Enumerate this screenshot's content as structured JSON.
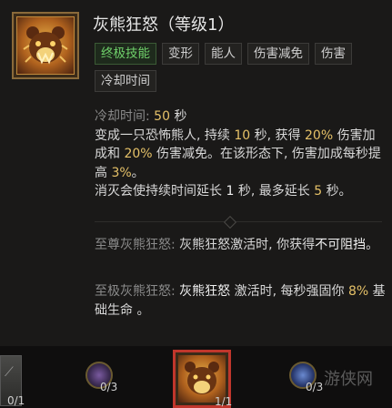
{
  "skill": {
    "title": "灰熊狂怒（等级1）",
    "icon": "bear-head-icon",
    "tags": [
      "终极技能",
      "变形",
      "能人",
      "伤害减免",
      "伤害",
      "冷却时间"
    ]
  },
  "description": {
    "cooldown_label": "冷却时间:",
    "cooldown_value": "50",
    "cooldown_unit": "秒",
    "p1_a": "变成一只恐怖熊人, 持续",
    "p1_duration": "10",
    "p1_b": "秒, 获得",
    "p1_dmg": "20%",
    "p1_c": "伤害加成和",
    "p1_dr": "20%",
    "p1_d": "伤害减免。在该形态下, 伤害加成每秒提高",
    "p1_inc": "3%",
    "p1_e": "。",
    "p2_a": "消灭会使持续时间延长",
    "p2_ext": "1",
    "p2_b": "秒, 最多延长",
    "p2_max": "5",
    "p2_c": "秒。"
  },
  "upgrades": [
    {
      "label": "至尊灰熊狂怒:",
      "text_a": "灰熊狂怒",
      "text_b": "激活时, 你获得",
      "text_c": "不可阻挡",
      "text_d": "。"
    },
    {
      "label": "至极灰熊狂怒:",
      "text_a": "灰熊狂怒",
      "text_b": "激活时, 每秒强固你",
      "value": "8%",
      "text_c": "基础生命",
      "text_d": "。"
    }
  ],
  "skill_bar": {
    "slots": [
      {
        "icon": "claw-icon",
        "count": "0/1"
      },
      {
        "icon": "spirit-orb-icon",
        "count": "0/3"
      },
      {
        "icon": "bear-head-icon",
        "count": "1/1"
      },
      {
        "icon": "frost-orb-icon",
        "count": "0/3"
      }
    ],
    "watermark": "游侠网"
  },
  "colors": {
    "ultimate_tag": "#6fd06a",
    "highlight": "#e5c168",
    "selected_border": "#c0362c"
  }
}
